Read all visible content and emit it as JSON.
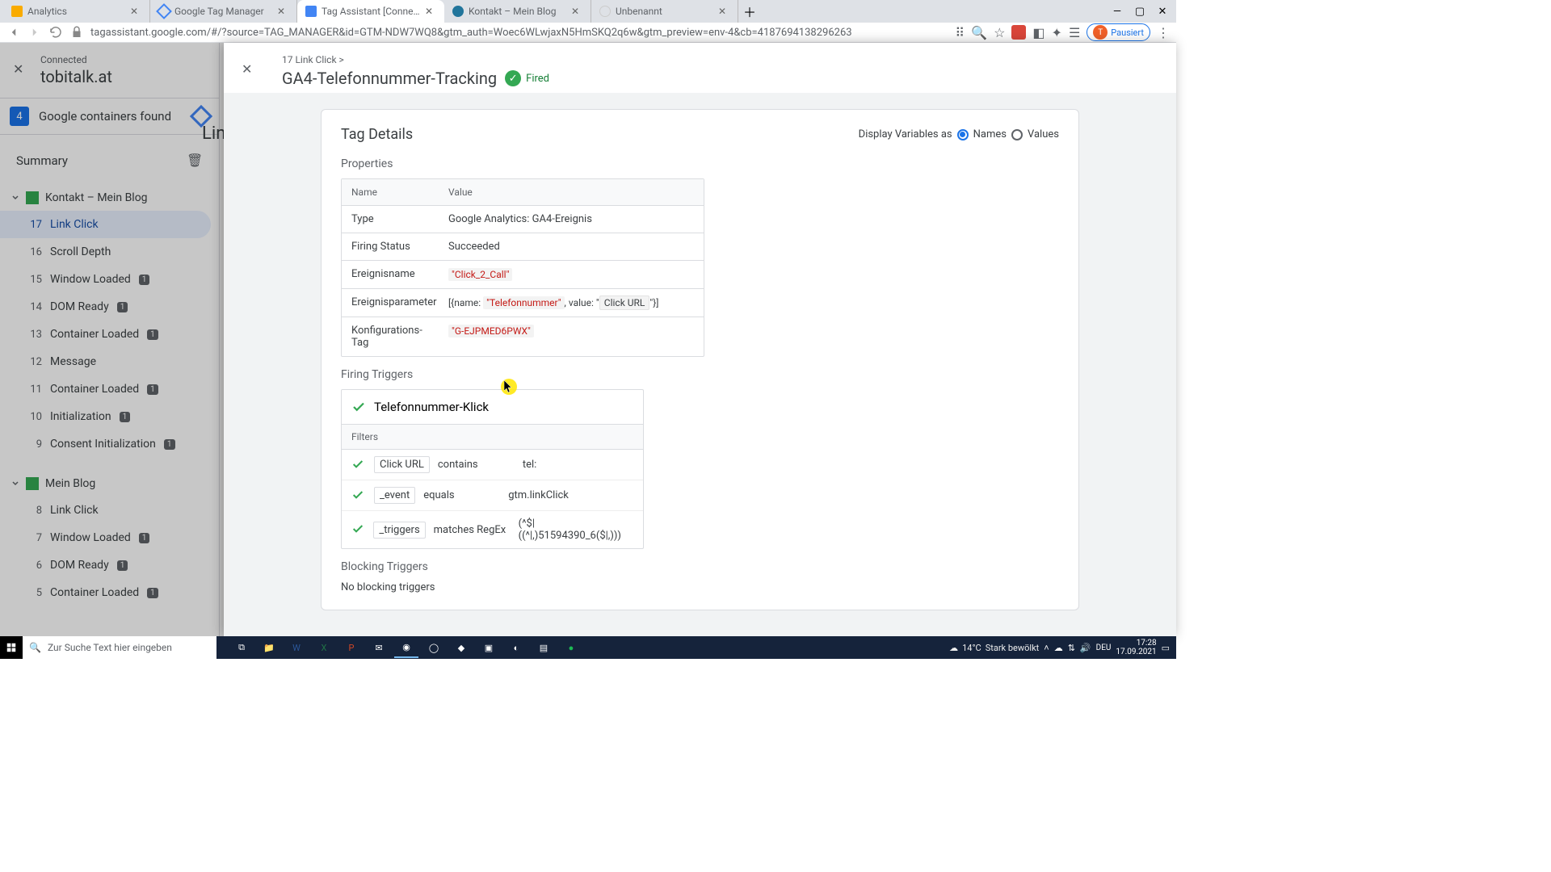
{
  "browser": {
    "tabs": [
      {
        "title": "Analytics"
      },
      {
        "title": "Google Tag Manager"
      },
      {
        "title": "Tag Assistant [Connected]"
      },
      {
        "title": "Kontakt – Mein Blog"
      },
      {
        "title": "Unbenannt"
      }
    ],
    "url": "tagassistant.google.com/#/?source=TAG_MANAGER&id=GTM-NDW7WQ8&gtm_auth=Woec6WLwjaxN5HmSKQ2q6w&gtm_preview=env-4&cb=4187694138296263",
    "pause": "Pausiert"
  },
  "sidebar": {
    "connected": "Connected",
    "domain": "tobitalk.at",
    "containers_count": "4",
    "containers_text": "Google containers found",
    "summary": "Summary",
    "groups": [
      {
        "title": "Kontakt – Mein Blog",
        "events": [
          {
            "n": "17",
            "t": "Link Click",
            "sel": true
          },
          {
            "n": "16",
            "t": "Scroll Depth"
          },
          {
            "n": "15",
            "t": "Window Loaded",
            "b": "1"
          },
          {
            "n": "14",
            "t": "DOM Ready",
            "b": "1"
          },
          {
            "n": "13",
            "t": "Container Loaded",
            "b": "1"
          },
          {
            "n": "12",
            "t": "Message"
          },
          {
            "n": "11",
            "t": "Container Loaded",
            "b": "1"
          },
          {
            "n": "10",
            "t": "Initialization",
            "b": "1"
          },
          {
            "n": "9",
            "t": "Consent Initialization",
            "b": "1"
          }
        ]
      },
      {
        "title": "Mein Blog",
        "events": [
          {
            "n": "8",
            "t": "Link Click"
          },
          {
            "n": "7",
            "t": "Window Loaded",
            "b": "1"
          },
          {
            "n": "6",
            "t": "DOM Ready",
            "b": "1"
          },
          {
            "n": "5",
            "t": "Container Loaded",
            "b": "1"
          }
        ]
      }
    ]
  },
  "modal": {
    "crumb": "17 Link Click >",
    "title": "GA4-Telefonnummer-Tracking",
    "fired": "Fired",
    "card_title": "Tag Details",
    "display_var_label": "Display Variables as",
    "radio_names": "Names",
    "radio_values": "Values",
    "sect_properties": "Properties",
    "th_name": "Name",
    "th_value": "Value",
    "rows": [
      {
        "k": "Type",
        "v": "Google Analytics: GA4-Ereignis"
      },
      {
        "k": "Firing Status",
        "v": "Succeeded"
      }
    ],
    "row_ereignis_k": "Ereignisname",
    "row_ereignis_v": "\"Click_2_Call\"",
    "row_param_k": "Ereignisparameter",
    "row_param_pre": "[{name: ",
    "row_param_name": "\"Telefonnummer\"",
    "row_param_mid": ", value: \"",
    "row_param_var": "Click URL",
    "row_param_post": "\"}]",
    "row_konf_k": "Konfigurations-Tag",
    "row_konf_v": "\"G-EJPMED6PWX\"",
    "sect_triggers": "Firing Triggers",
    "trigger_name": "Telefonnummer-Klick",
    "filters_label": "Filters",
    "filters": [
      {
        "var": "Click URL",
        "op": "contains",
        "val": "tel:"
      },
      {
        "var": "_event",
        "op": "equals",
        "val": "gtm.linkClick"
      },
      {
        "var": "_triggers",
        "op": "matches RegEx",
        "val": "(^$|((^|,)51594390_6($|,)))"
      }
    ],
    "sect_block": "Blocking Triggers",
    "block_none": "No blocking triggers"
  },
  "taskbar": {
    "search_ph": "Zur Suche Text hier eingeben",
    "weather_temp": "14°C",
    "weather_txt": "Stark bewölkt",
    "time": "17:28",
    "date": "17.09.2021"
  },
  "hidden_heading": "Link"
}
